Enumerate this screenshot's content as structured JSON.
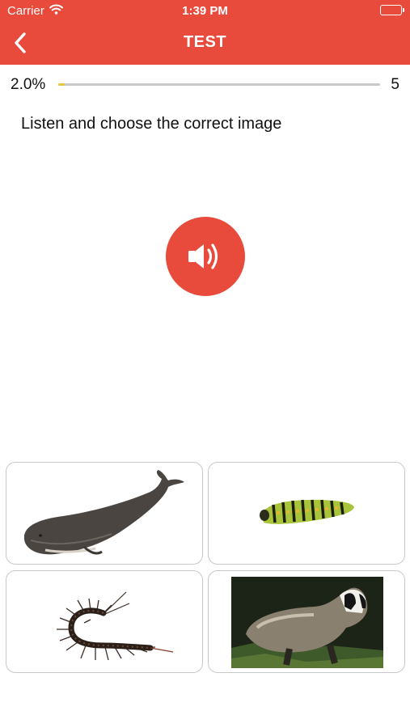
{
  "status_bar": {
    "carrier": "Carrier",
    "time": "1:39 PM"
  },
  "header": {
    "title": "TEST",
    "back_icon": "chevron-left-icon",
    "color": "#e84a3c"
  },
  "progress": {
    "percent_label": "2.0%",
    "fraction": 0.02,
    "total": "5",
    "fill_color": "#e8c640"
  },
  "question": {
    "instruction": "Listen and choose the correct image",
    "audio_icon": "speaker-icon"
  },
  "options": [
    {
      "subject": "sperm whale"
    },
    {
      "subject": "caterpillar"
    },
    {
      "subject": "centipede"
    },
    {
      "subject": "badger"
    }
  ]
}
